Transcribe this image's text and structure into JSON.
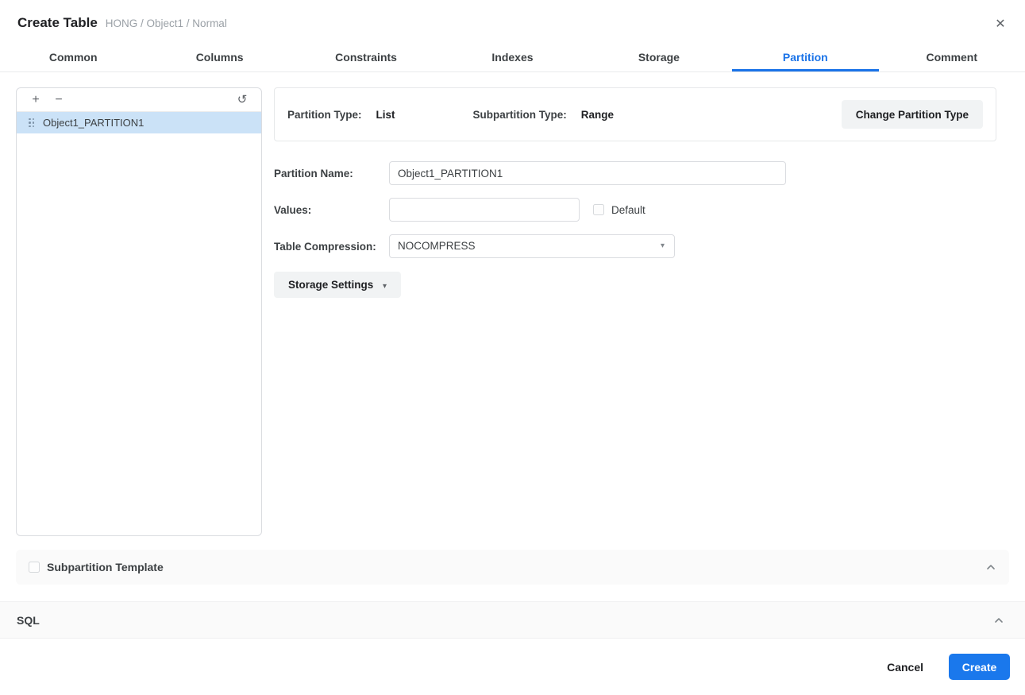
{
  "header": {
    "title": "Create Table",
    "breadcrumb": "HONG / Object1 / Normal",
    "close_icon": "✕"
  },
  "tabs": [
    {
      "label": "Common",
      "active": false
    },
    {
      "label": "Columns",
      "active": false
    },
    {
      "label": "Constraints",
      "active": false
    },
    {
      "label": "Indexes",
      "active": false
    },
    {
      "label": "Storage",
      "active": false
    },
    {
      "label": "Partition",
      "active": true
    },
    {
      "label": "Comment",
      "active": false
    }
  ],
  "left_panel": {
    "add_icon": "+",
    "remove_icon": "−",
    "refresh_icon": "↺",
    "items": [
      {
        "label": "Object1_PARTITION1",
        "selected": true
      }
    ]
  },
  "info_bar": {
    "partition_type_label": "Partition Type:",
    "partition_type_value": "List",
    "subpartition_type_label": "Subpartition Type:",
    "subpartition_type_value": "Range",
    "change_button_label": "Change Partition Type"
  },
  "form": {
    "partition_name": {
      "label": "Partition Name:",
      "value": "Object1_PARTITION1"
    },
    "values": {
      "label": "Values:",
      "value": "",
      "default_checkbox_label": "Default",
      "default_checked": false
    },
    "table_compression": {
      "label": "Table Compression:",
      "value": "NOCOMPRESS",
      "caret_icon": "▾"
    },
    "storage_settings": {
      "label": "Storage Settings",
      "caret_icon": "▾"
    }
  },
  "sections": {
    "subpartition_template": {
      "label": "Subpartition Template",
      "checked": false,
      "collapsed": false
    },
    "sql": {
      "label": "SQL",
      "collapsed": false
    }
  },
  "footer": {
    "cancel_label": "Cancel",
    "create_label": "Create"
  },
  "colors": {
    "accent_blue": "#1a73e8",
    "create_button_bg": "#1a78ec",
    "selected_item_bg": "#cbe2f7",
    "section_bar_bg": "#fafafa",
    "gray_button_bg": "#f1f3f4",
    "border": "#dadce0"
  }
}
